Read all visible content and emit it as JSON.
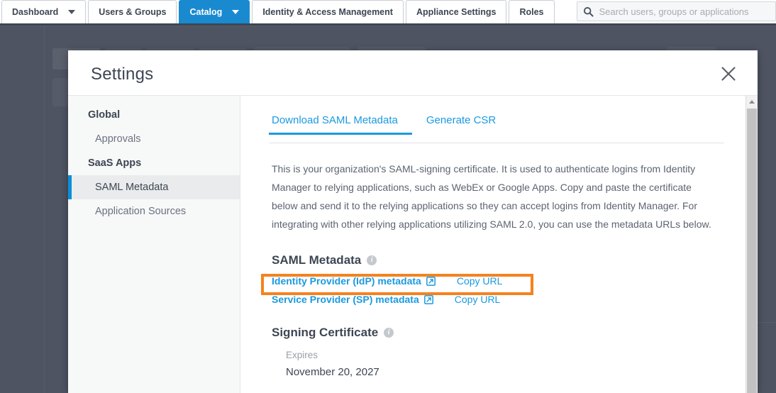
{
  "topnav": {
    "tabs": [
      {
        "label": "Dashboard",
        "active": false,
        "caret": true,
        "icon": "chevron-down-icon"
      },
      {
        "label": "Users & Groups",
        "active": false,
        "caret": false
      },
      {
        "label": "Catalog",
        "active": true,
        "caret": true,
        "icon": "chevron-down-icon"
      },
      {
        "label": "Identity & Access Management",
        "active": false,
        "caret": false
      },
      {
        "label": "Appliance Settings",
        "active": false,
        "caret": false
      },
      {
        "label": "Roles",
        "active": false,
        "caret": false
      }
    ],
    "search": {
      "icon": "search-icon",
      "placeholder": "Search users, groups or applications",
      "value": ""
    }
  },
  "modal": {
    "title": "Settings",
    "close_icon": "close-icon",
    "sidebar": {
      "items": [
        {
          "label": "Global",
          "type": "group",
          "active": false
        },
        {
          "label": "Approvals",
          "type": "item",
          "active": false
        },
        {
          "label": "SaaS Apps",
          "type": "group",
          "active": false
        },
        {
          "label": "SAML Metadata",
          "type": "item",
          "active": true
        },
        {
          "label": "Application Sources",
          "type": "item",
          "active": false
        }
      ]
    },
    "tabs": [
      {
        "label": "Download SAML Metadata",
        "active": true
      },
      {
        "label": "Generate CSR",
        "active": false
      }
    ],
    "intro": "This is your organization's SAML-signing certificate. It is used to authenticate logins from Identity Manager to relying applications, such as WebEx or Google Apps. Copy and paste the certificate below and send it to the relying applications so they can accept logins from Identity Manager. For integrating with other relying applications utilizing SAML 2.0, you can use the metadata URLs below.",
    "saml_metadata": {
      "heading": "SAML Metadata",
      "info_icon": "info-icon",
      "info_glyph": "i",
      "links": [
        {
          "label": "Identity Provider (IdP) metadata",
          "external_icon": "external-link-icon",
          "copy_label": "Copy URL",
          "highlighted": true
        },
        {
          "label": "Service Provider (SP) metadata",
          "external_icon": "external-link-icon",
          "copy_label": "Copy URL",
          "highlighted": false
        }
      ]
    },
    "signing_certificate": {
      "heading": "Signing Certificate",
      "info_icon": "info-icon",
      "info_glyph": "i",
      "expires_label": "Expires",
      "expires_value": "November 20, 2027"
    },
    "scrollbar": {
      "up_arrow_icon": "scroll-up-arrow-icon"
    }
  },
  "colors": {
    "accent_blue": "#1b9ae0",
    "nav_active_blue": "#1a8ad0",
    "highlight_orange": "#f5821f",
    "overlay": "#4e5462",
    "text_dark": "#3d4653"
  }
}
